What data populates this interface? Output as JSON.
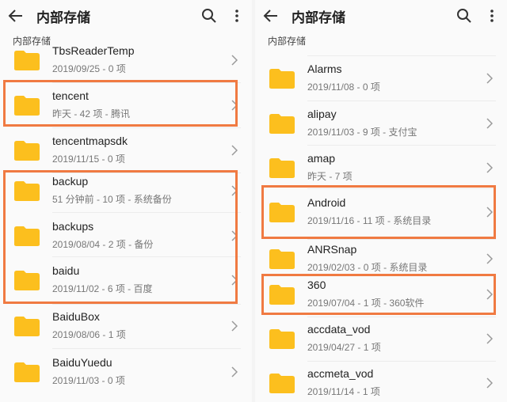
{
  "left": {
    "title": "内部存储",
    "section": "内部存储",
    "items": [
      {
        "name": "TbsReaderTemp",
        "meta": "2019/09/25 - 0 项"
      },
      {
        "name": "tencent",
        "meta": "昨天 - 42 项 - 腾讯"
      },
      {
        "name": "tencentmapsdk",
        "meta": "2019/11/15 - 0 项"
      },
      {
        "name": "backup",
        "meta": "51 分钟前 - 10 项 - 系统备份"
      },
      {
        "name": "backups",
        "meta": "2019/08/04 - 2 项 - 备份"
      },
      {
        "name": "baidu",
        "meta": "2019/11/02 - 6 项 - 百度"
      },
      {
        "name": "BaiduBox",
        "meta": "2019/08/06 - 1 项"
      },
      {
        "name": "BaiduYuedu",
        "meta": "2019/11/03 - 0 项"
      }
    ]
  },
  "right": {
    "title": "内部存储",
    "section": "内部存储",
    "items": [
      {
        "name": "Alarms",
        "meta": "2019/11/08 - 0 项"
      },
      {
        "name": "alipay",
        "meta": "2019/11/03 - 9 项 - 支付宝"
      },
      {
        "name": "amap",
        "meta": "昨天 - 7 项"
      },
      {
        "name": "Android",
        "meta": "2019/11/16 - 11 项 - 系统目录"
      },
      {
        "name": "ANRSnap",
        "meta": "2019/02/03 - 0 项 - 系统目录"
      },
      {
        "name": "360",
        "meta": "2019/07/04 - 1 项 - 360软件"
      },
      {
        "name": "accdata_vod",
        "meta": "2019/04/27 - 1 项"
      },
      {
        "name": "accmeta_vod",
        "meta": "2019/11/14 - 1 项"
      }
    ]
  },
  "colors": {
    "folder": "#fcbf1e",
    "highlight": "#f07a42"
  }
}
